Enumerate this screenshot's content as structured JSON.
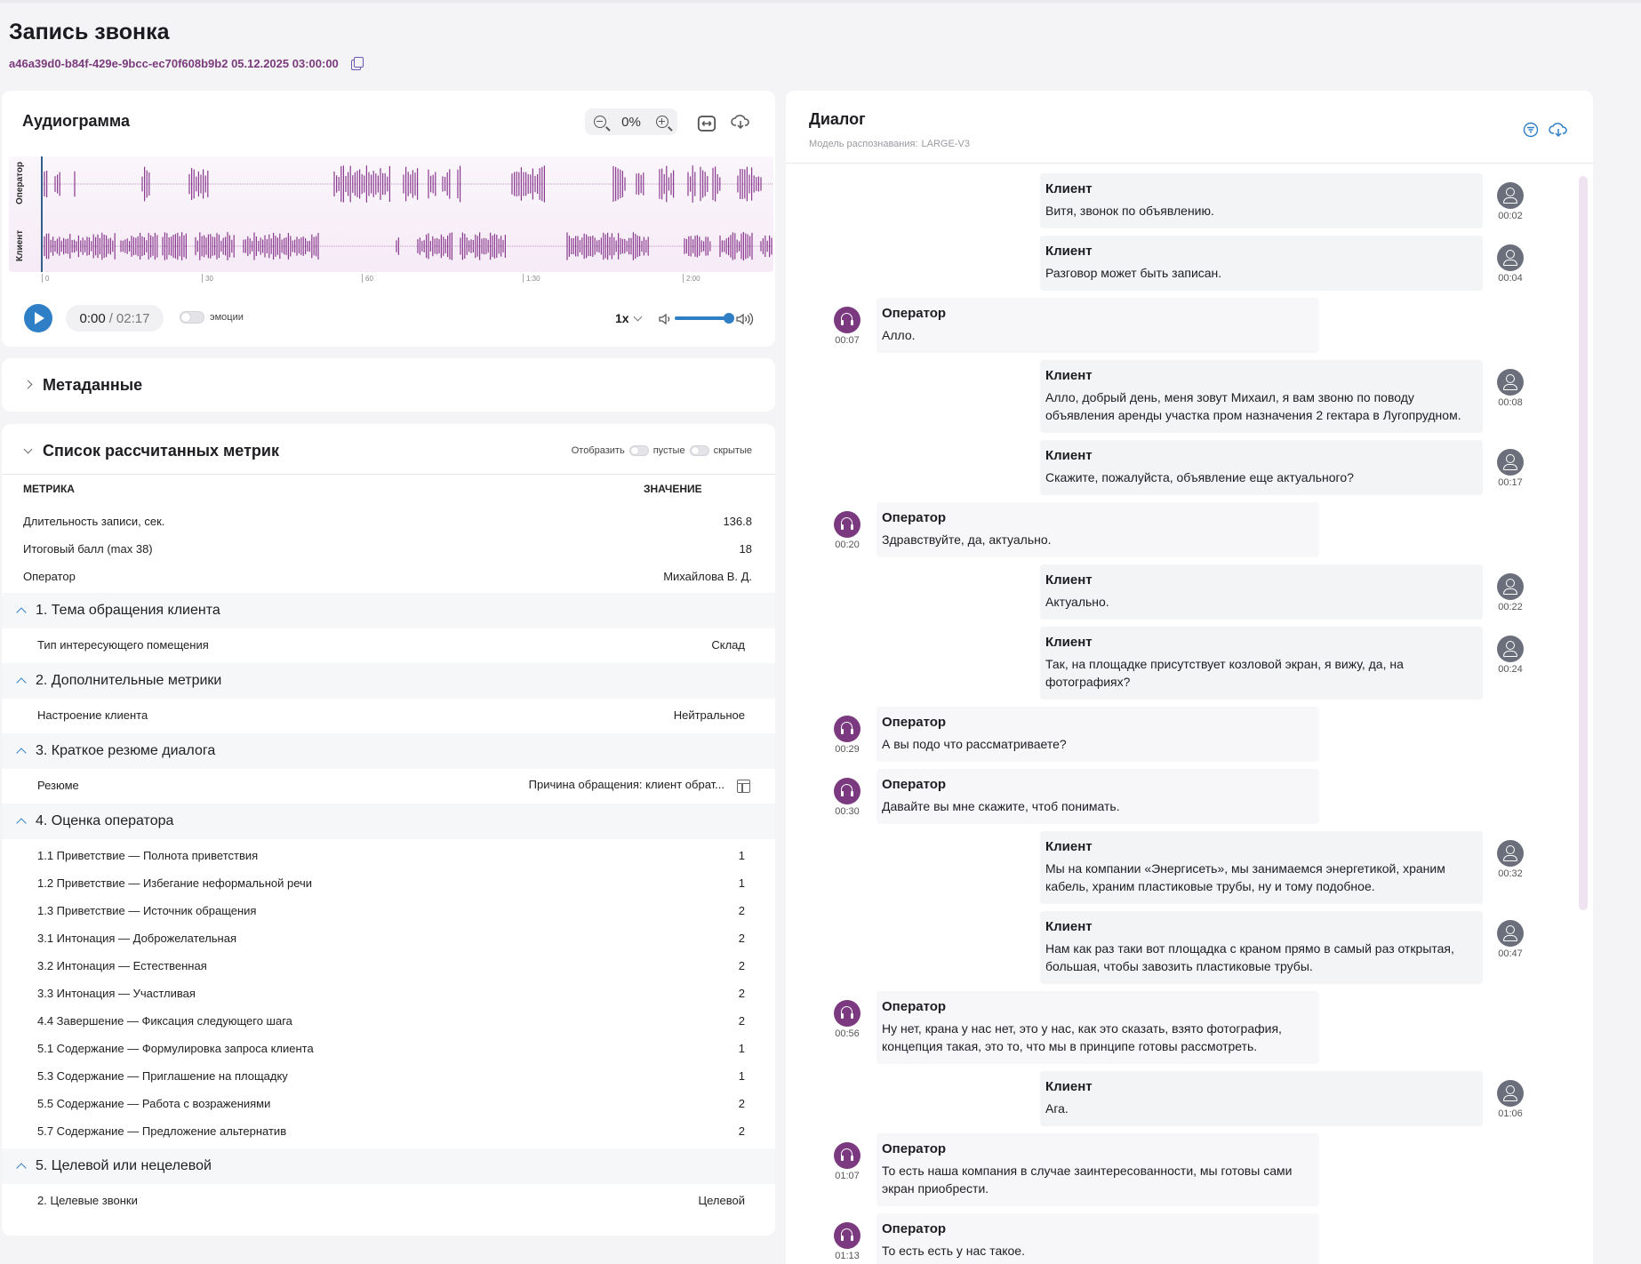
{
  "header": {
    "title": "Запись звонка",
    "record_id": "a46a39d0-b84f-429e-9bcc-ec70f608b9b2",
    "datetime": "05.12.2025 03:00:00"
  },
  "audio": {
    "title": "Аудиограмма",
    "zoom": "0%",
    "track_operator": "Оператор",
    "track_client": "Клиент",
    "ticks": [
      "0",
      "30",
      "60",
      "1:30",
      "2:00"
    ],
    "time_current": "0:00",
    "time_separator": "/",
    "time_total": "02:17",
    "emotions_label": "эмоции",
    "speed": "1x",
    "volume": 0.85,
    "colors": {
      "wave": "#8a3a8e",
      "accent": "#2f7fc6"
    }
  },
  "metadata": {
    "title": "Метаданные"
  },
  "metrics": {
    "title": "Список рассчитанных метрик",
    "show_label": "Отобразить",
    "empty_label": "пустые",
    "hidden_label": "скрытые",
    "col_metric": "МЕТРИКА",
    "col_value": "ЗНАЧЕНИЕ",
    "top_rows": [
      {
        "label": "Длительность записи, сек.",
        "value": "136.8"
      },
      {
        "label": "Итоговый балл (max 38)",
        "value": "18"
      },
      {
        "label": "Оператор",
        "value": "Михайлова В. Д."
      }
    ],
    "groups": [
      {
        "title": "1. Тема обращения клиента",
        "rows": [
          {
            "label": "Тип интересующего помещения",
            "value": "Склад"
          }
        ]
      },
      {
        "title": "2. Дополнительные метрики",
        "rows": [
          {
            "label": "Настроение клиента",
            "value": "Нейтральное"
          }
        ]
      },
      {
        "title": "3. Краткое резюме диалога",
        "rows": [
          {
            "label": "Резюме",
            "value": "Причина обращения: клиент обрат..."
          }
        ]
      },
      {
        "title": "4. Оценка оператора",
        "rows": [
          {
            "label": "1.1 Приветствие — Полнота приветствия",
            "value": "1"
          },
          {
            "label": "1.2 Приветствие — Избегание неформальной речи",
            "value": "1"
          },
          {
            "label": "1.3 Приветствие — Источник обращения",
            "value": "2"
          },
          {
            "label": "3.1 Интонация — Доброжелательная",
            "value": "2"
          },
          {
            "label": "3.2 Интонация — Естественная",
            "value": "2"
          },
          {
            "label": "3.3 Интонация — Участливая",
            "value": "2"
          },
          {
            "label": "4.4 Завершение — Фиксация следующего шага",
            "value": "2"
          },
          {
            "label": "5.1 Содержание — Формулировка запроса клиента",
            "value": "1"
          },
          {
            "label": "5.3 Содержание — Приглашение на площадку",
            "value": "1"
          },
          {
            "label": "5.5 Содержание — Работа с возражениями",
            "value": "2"
          },
          {
            "label": "5.7 Содержание — Предложение альтернатив",
            "value": "2"
          }
        ]
      },
      {
        "title": "5. Целевой или нецелевой",
        "rows": [
          {
            "label": "2. Целевые звонки",
            "value": "Целевой"
          }
        ]
      }
    ]
  },
  "dialog": {
    "title": "Диалог",
    "model_label": "Модель распознавания:",
    "model_value": "LARGE-V3",
    "messages": [
      {
        "role": "client",
        "speaker": "Клиент",
        "time": "00:02",
        "text": "Витя, звонок по объявлению."
      },
      {
        "role": "client",
        "speaker": "Клиент",
        "time": "00:04",
        "text": "Разговор может быть записан."
      },
      {
        "role": "oper",
        "speaker": "Оператор",
        "time": "00:07",
        "text": "Алло."
      },
      {
        "role": "client",
        "speaker": "Клиент",
        "time": "00:08",
        "text": "Алло, добрый день, меня зовут Михаил, я вам звоню по поводу объявления аренды участка пром назначения 2 гектара в Лугопрудном."
      },
      {
        "role": "client",
        "speaker": "Клиент",
        "time": "00:17",
        "text": "Скажите, пожалуйста, объявление еще актуального?"
      },
      {
        "role": "oper",
        "speaker": "Оператор",
        "time": "00:20",
        "text": "Здравствуйте, да, актуально."
      },
      {
        "role": "client",
        "speaker": "Клиент",
        "time": "00:22",
        "text": "Актуально."
      },
      {
        "role": "client",
        "speaker": "Клиент",
        "time": "00:24",
        "text": "Так, на площадке присутствует козловой экран, я вижу, да, на фотографиях?"
      },
      {
        "role": "oper",
        "speaker": "Оператор",
        "time": "00:29",
        "text": "А вы подо что рассматриваете?"
      },
      {
        "role": "oper",
        "speaker": "Оператор",
        "time": "00:30",
        "text": "Давайте вы мне скажите, чтоб понимать."
      },
      {
        "role": "client",
        "speaker": "Клиент",
        "time": "00:32",
        "text": "Мы на компании «Энергисеть», мы занимаемся энергетикой, храним кабель, храним пластиковые трубы, ну и тому подобное."
      },
      {
        "role": "client",
        "speaker": "Клиент",
        "time": "00:47",
        "text": "Нам как раз таки вот площадка с краном прямо в самый раз открытая, большая, чтобы завозить пластиковые трубы."
      },
      {
        "role": "oper",
        "speaker": "Оператор",
        "time": "00:56",
        "text": "Ну нет, крана у нас нет, это у нас, как это сказать, взято фотография, концепция такая, это то, что мы в принципе готовы рассмотреть."
      },
      {
        "role": "client",
        "speaker": "Клиент",
        "time": "01:06",
        "text": "Ага."
      },
      {
        "role": "oper",
        "speaker": "Оператор",
        "time": "01:07",
        "text": "То есть наша компания в случае заинтересованности, мы готовы сами экран приобрести."
      },
      {
        "role": "oper",
        "speaker": "Оператор",
        "time": "01:13",
        "text": "То есть есть у нас такое."
      }
    ]
  }
}
